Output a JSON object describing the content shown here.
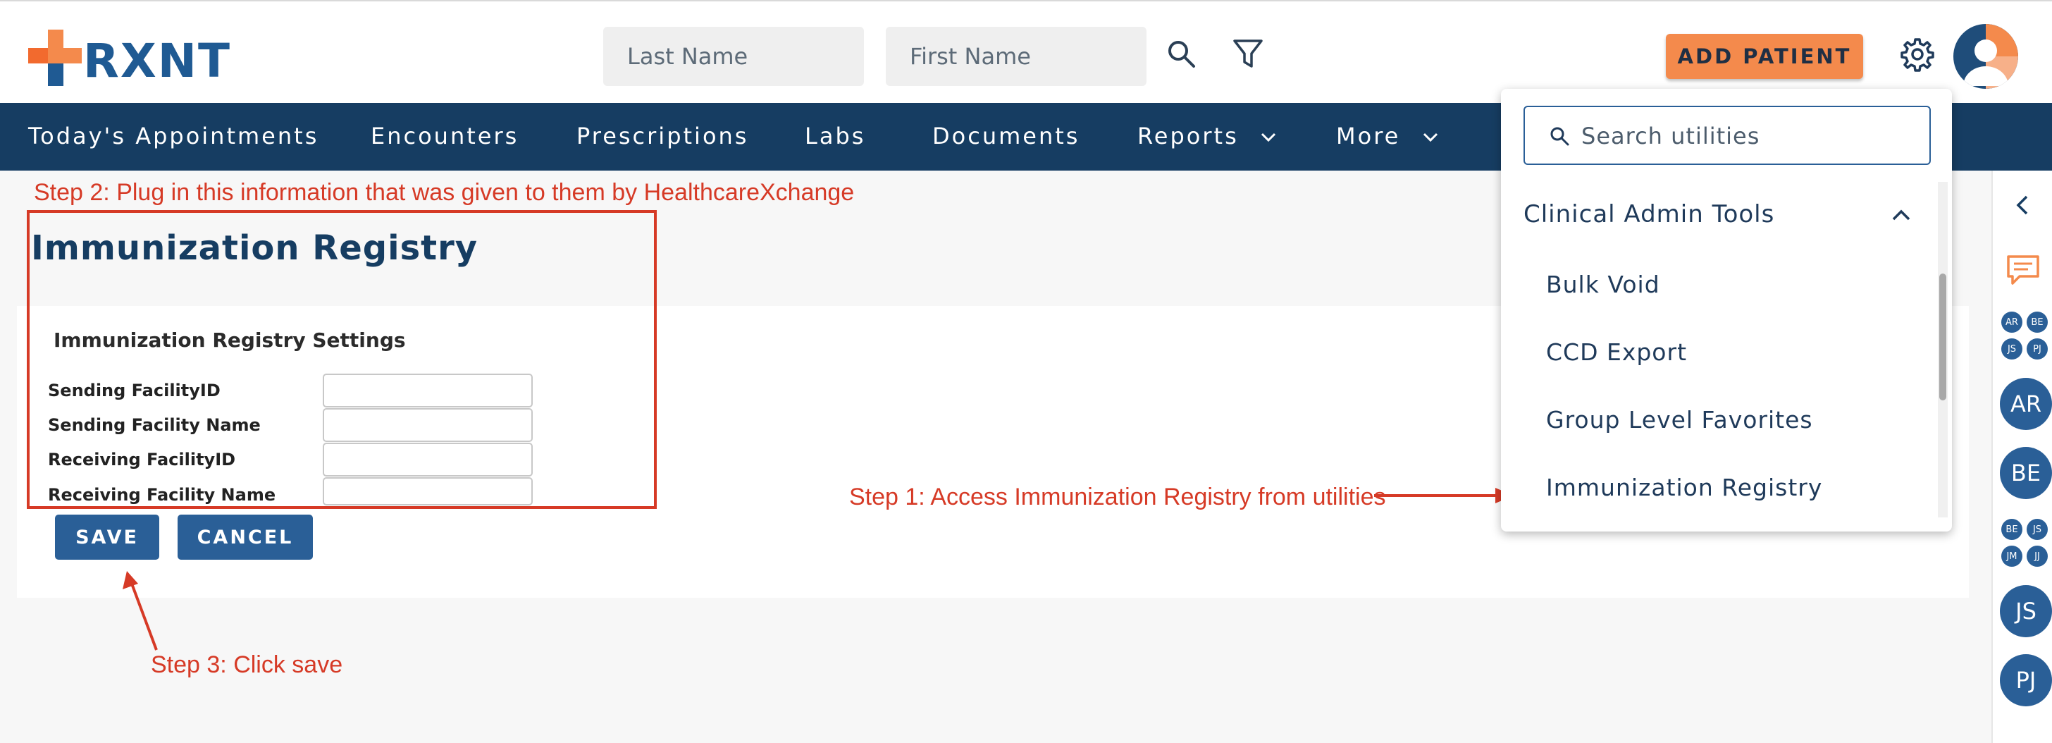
{
  "brand": {
    "name": "RXNT"
  },
  "header": {
    "last_name_placeholder": "Last Name",
    "first_name_placeholder": "First Name",
    "add_patient_label": "ADD PATIENT"
  },
  "nav": {
    "items": [
      "Today's Appointments",
      "Encounters",
      "Prescriptions",
      "Labs",
      "Documents",
      "Reports",
      "More"
    ]
  },
  "annotations": {
    "step1": "Step 1: Access Immunization Registry from utilities",
    "step2": "Step 2: Plug in this information that was given to them by HealthcareXchange",
    "step3": "Step 3: Click save"
  },
  "page": {
    "title": "Immunization Registry",
    "settings_title": "Immunization Registry Settings",
    "fields": [
      {
        "label": "Sending FacilityID",
        "value": ""
      },
      {
        "label": "Sending Facility Name",
        "value": ""
      },
      {
        "label": "Receiving FacilityID",
        "value": ""
      },
      {
        "label": "Receiving Facility Name",
        "value": ""
      }
    ],
    "save_label": "SAVE",
    "cancel_label": "CANCEL"
  },
  "utilities": {
    "search_placeholder": "Search utilities",
    "group": "Clinical Admin Tools",
    "items": [
      "Bulk Void",
      "CCD Export",
      "Group Level Favorites",
      "Immunization Registry"
    ]
  },
  "rail": {
    "mini_group_1": [
      "AR",
      "BE",
      "JS",
      "PJ"
    ],
    "big_1": "AR",
    "big_2": "BE",
    "mini_group_2": [
      "BE",
      "JS",
      "JM",
      "JJ"
    ],
    "big_3": "JS",
    "big_4": "PJ"
  },
  "colors": {
    "navy": "#163d62",
    "accent_orange": "#f48a4c",
    "button_blue": "#2a5f97",
    "annotation_red": "#d63a26"
  },
  "icons": [
    "search-icon",
    "filter-icon",
    "gear-icon",
    "avatar-icon",
    "chevron-down-icon",
    "chevron-up-icon",
    "chevron-left-icon",
    "chat-icon"
  ]
}
